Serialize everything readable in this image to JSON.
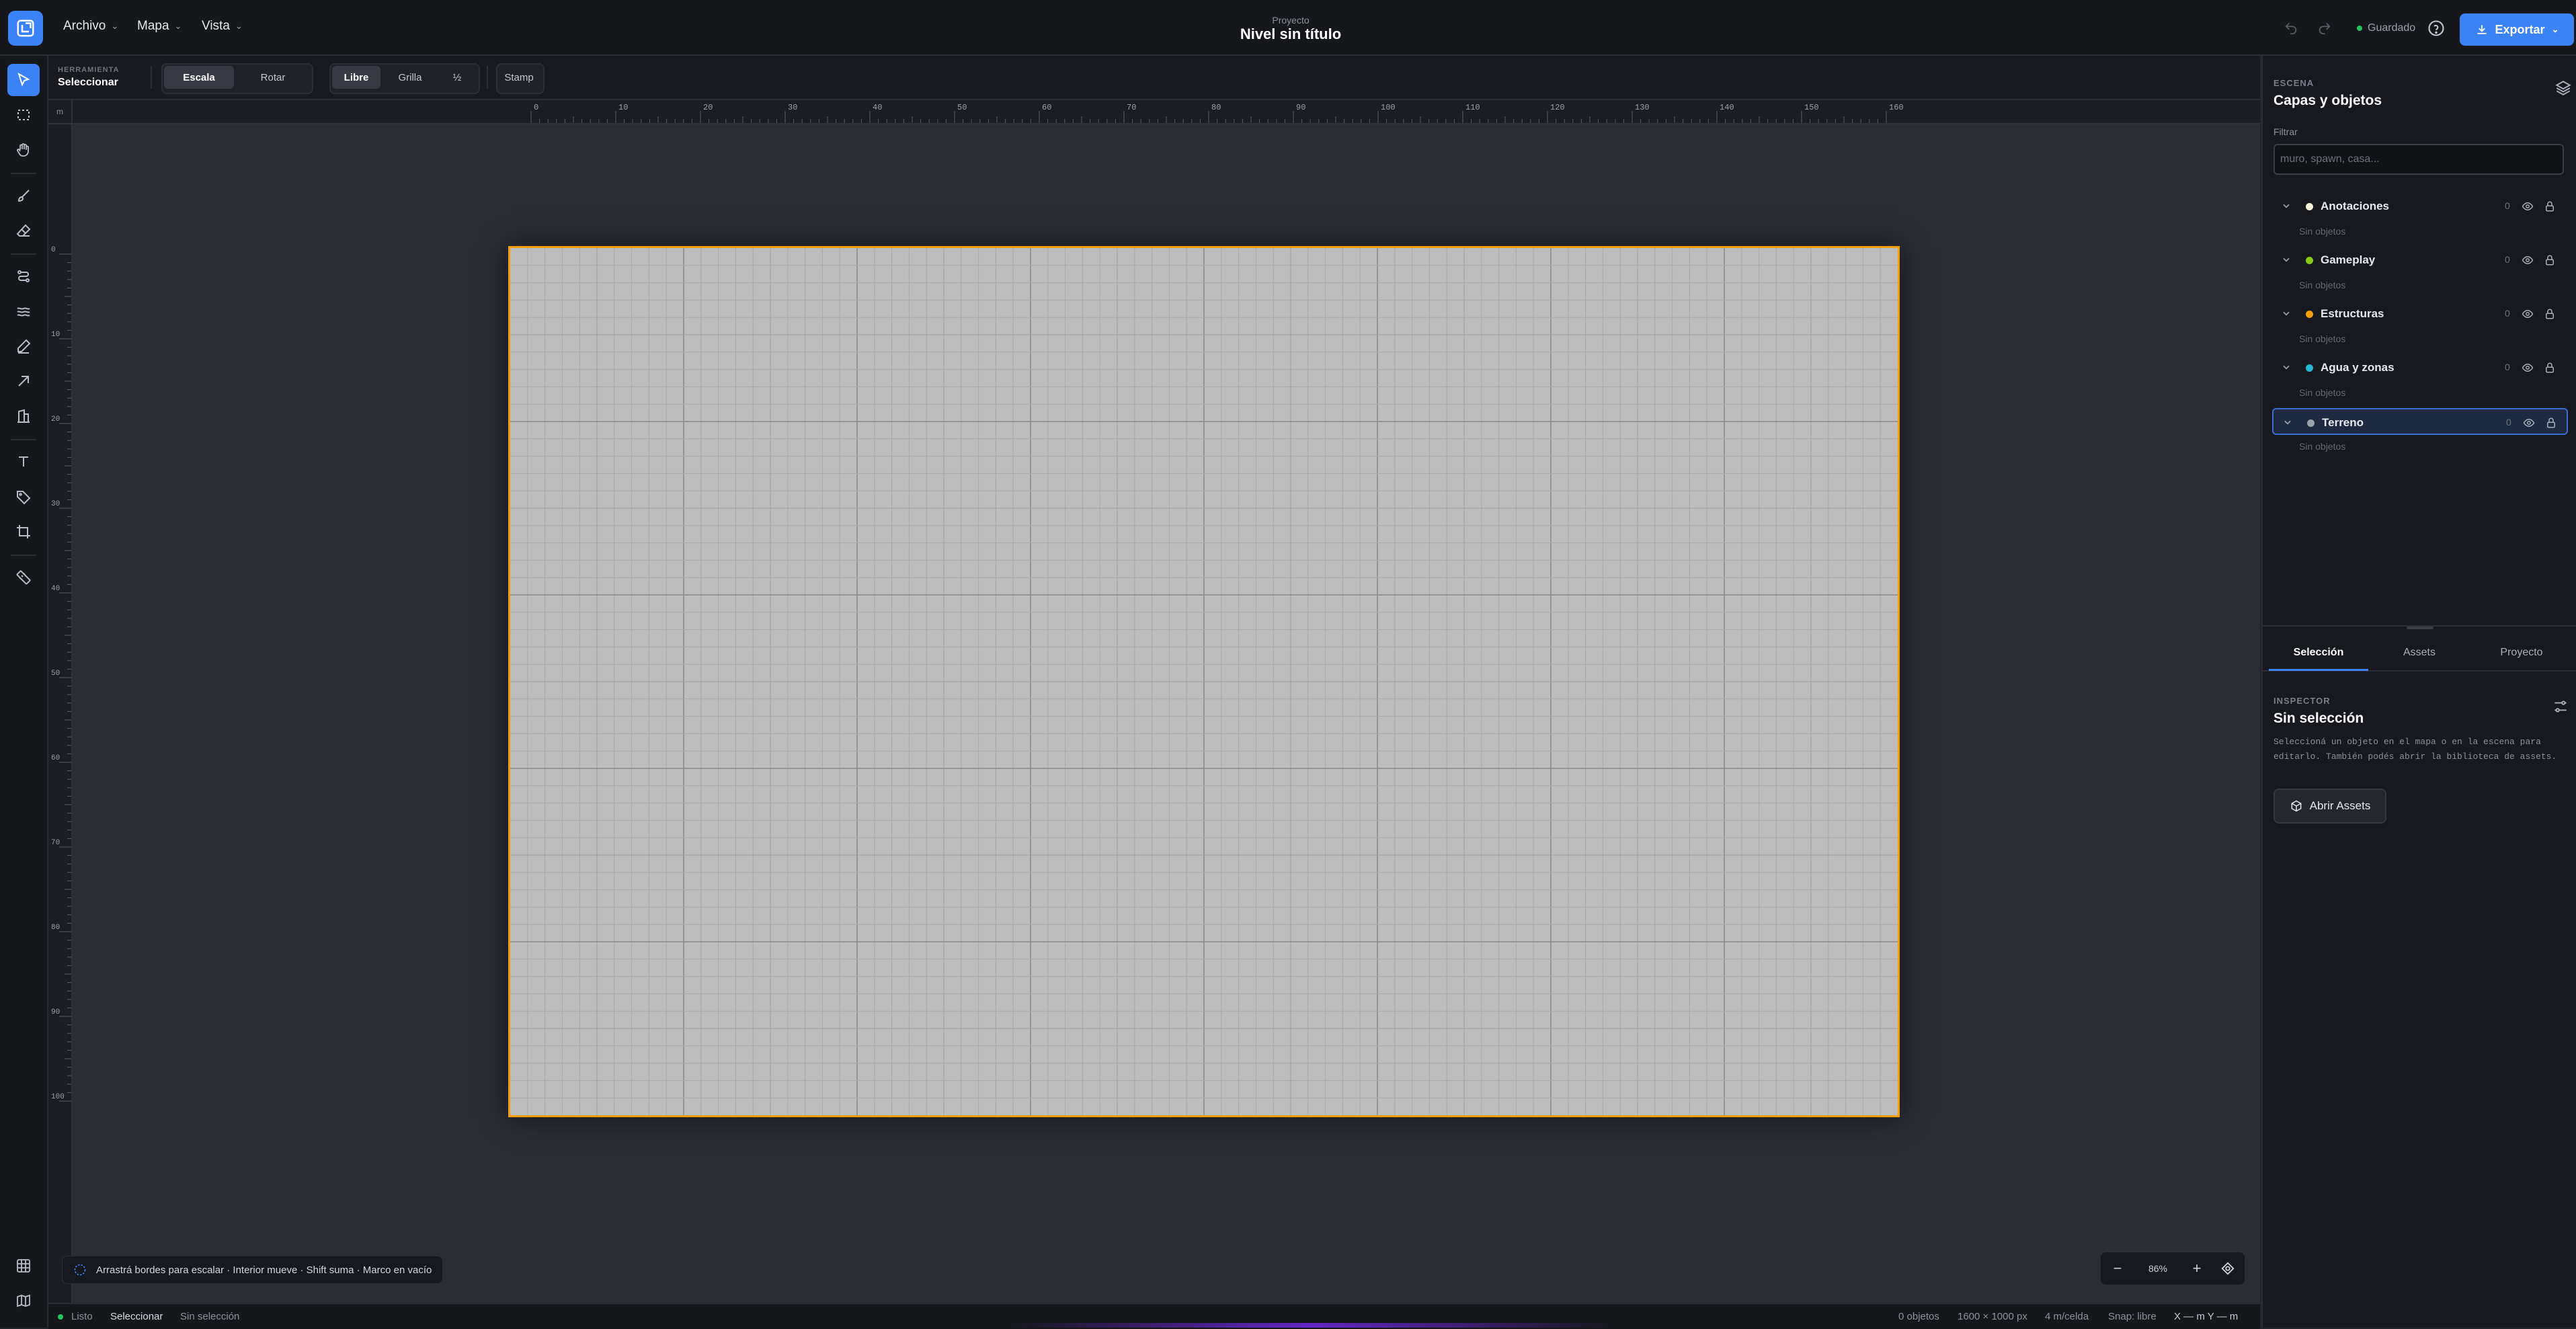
{
  "topbar": {
    "menus": [
      "Archivo",
      "Mapa",
      "Vista"
    ],
    "project_label": "Proyecto",
    "project_title": "Nivel sin título",
    "saved_label": "Guardado",
    "export_label": "Exportar"
  },
  "options": {
    "tool_heading": "HERRAMIENTA",
    "tool_name": "Seleccionar",
    "mode_buttons": [
      "Escala",
      "Rotar"
    ],
    "snap_buttons": [
      "Libre",
      "Grilla",
      "½"
    ],
    "stamp_label": "Stamp"
  },
  "rulers": {
    "unit": "m",
    "top_ticks": [
      "0",
      "10",
      "20",
      "30",
      "40",
      "50",
      "60",
      "70",
      "80",
      "90",
      "100",
      "110",
      "120",
      "130",
      "140",
      "150",
      "160"
    ],
    "left_ticks": [
      "0",
      "10",
      "20",
      "30",
      "40",
      "50",
      "60",
      "70",
      "80",
      "90",
      "100"
    ]
  },
  "canvas": {
    "hint": "Arrastrá bordes para escalar · Interior mueve · Shift suma · Marco en vacío",
    "zoom_value": "86%",
    "map_border_color": "#f59e0b"
  },
  "status": {
    "state": "Listo",
    "tool": "Seleccionar",
    "selection": "Sin selección",
    "objects": "0 objetos",
    "dimensions": "1600 × 1000 px",
    "cell": "4 m/celda",
    "snap": "Snap: libre",
    "coords": "X — m  Y — m"
  },
  "scene": {
    "heading": "ESCENA",
    "title": "Capas y objetos",
    "filter_label": "Filtrar",
    "filter_placeholder": "muro, spawn, casa...",
    "layers": [
      {
        "name": "Anotaciones",
        "count": "0",
        "color": "#f5f0d8",
        "empty": "Sin objetos"
      },
      {
        "name": "Gameplay",
        "count": "0",
        "color": "#84cc16",
        "empty": "Sin objetos"
      },
      {
        "name": "Estructuras",
        "count": "0",
        "color": "#f59e0b",
        "empty": "Sin objetos"
      },
      {
        "name": "Agua y zonas",
        "count": "0",
        "color": "#22b8d8",
        "empty": "Sin objetos"
      },
      {
        "name": "Terreno",
        "count": "0",
        "color": "#9ca3af",
        "empty": "Sin objetos"
      }
    ]
  },
  "tabs": [
    "Selección",
    "Assets",
    "Proyecto"
  ],
  "inspector": {
    "heading": "INSPECTOR",
    "title": "Sin selección",
    "text": "Seleccioná un objeto en el mapa o en la escena para editarlo. También podés abrir la biblioteca de assets.",
    "open_assets_label": "Abrir Assets"
  },
  "colors": {
    "accent": "#3b82f6",
    "map_fill": "#bdbdbd"
  }
}
